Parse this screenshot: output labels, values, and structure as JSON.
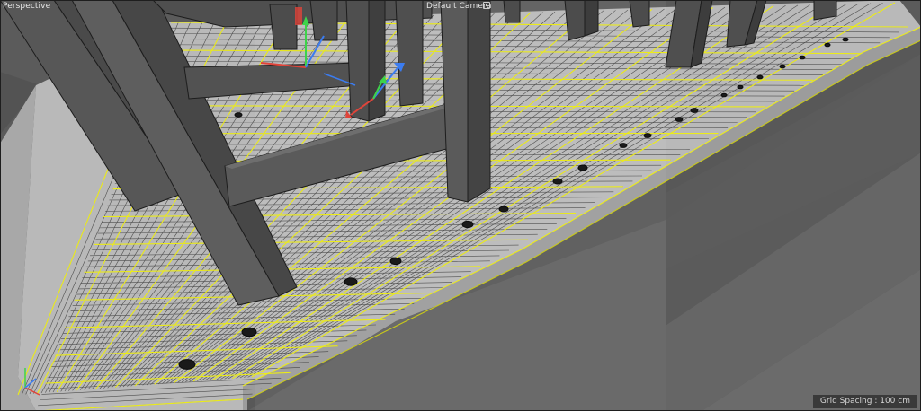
{
  "viewport": {
    "view_name": "Perspective",
    "camera_name": "Default Camera",
    "camera_icon": "camera-icon",
    "grid_info": "Grid Spacing : 100 cm"
  },
  "colors": {
    "background": "#5c5c5c",
    "floor": "#b7b7b7",
    "wire": "#2a2a2a",
    "selection": "#f0f000",
    "beam": "#555555",
    "axis_x": "#e0443a",
    "axis_y": "#3ed34a",
    "axis_z": "#3b7cf0"
  }
}
